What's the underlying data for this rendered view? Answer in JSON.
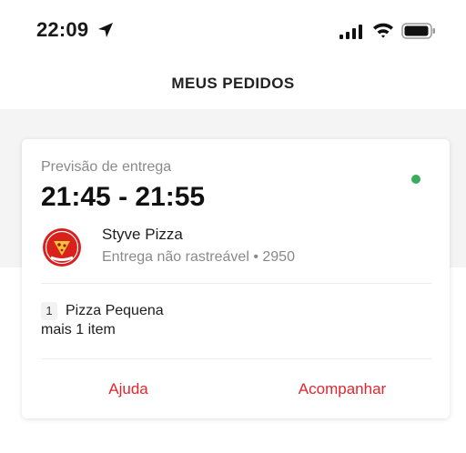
{
  "status_bar": {
    "time": "22:09",
    "icons": [
      "location-arrow-icon",
      "signal-icon",
      "wifi-icon",
      "battery-icon"
    ]
  },
  "header": {
    "title": "MEUS PEDIDOS"
  },
  "order": {
    "eta_label": "Previsão de entrega",
    "eta_time": "21:45 - 21:55",
    "status_color": "#3bab5e",
    "store": {
      "name": "Styve Pizza",
      "info": "Entrega não rastreável • 2950",
      "logo_text": "STYVE"
    },
    "items": [
      {
        "quantity": "1",
        "name": "Pizza Pequena"
      }
    ],
    "more_items": "mais 1 item",
    "actions": {
      "help": "Ajuda",
      "track": "Acompanhar"
    }
  },
  "colors": {
    "accent": "#e0262e",
    "background_band": "#f4f4f4"
  }
}
